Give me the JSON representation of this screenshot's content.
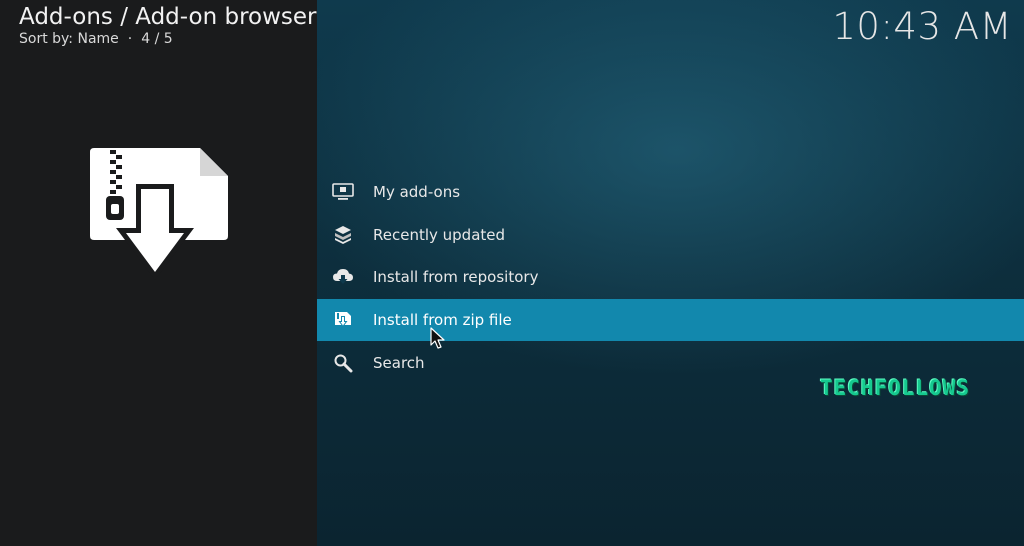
{
  "header": {
    "title": "Add-ons / Add-on browser",
    "sort_label": "Sort by: Name",
    "separator": "·",
    "position": "4 / 5"
  },
  "clock": "10:43 AM",
  "preview": {
    "icon": "zip-download-icon"
  },
  "menu": {
    "selected_index": 3,
    "items": [
      {
        "label": "My add-ons",
        "icon": "monitor-box-icon"
      },
      {
        "label": "Recently updated",
        "icon": "box-stack-icon"
      },
      {
        "label": "Install from repository",
        "icon": "cloud-download-icon"
      },
      {
        "label": "Install from zip file",
        "icon": "zip-file-icon"
      },
      {
        "label": "Search",
        "icon": "search-icon"
      }
    ]
  },
  "watermark": "TECHFOLLOWS",
  "colors": {
    "left_panel": "#1a1b1c",
    "selected_row": "#1288ad",
    "watermark": "#16c98f"
  }
}
